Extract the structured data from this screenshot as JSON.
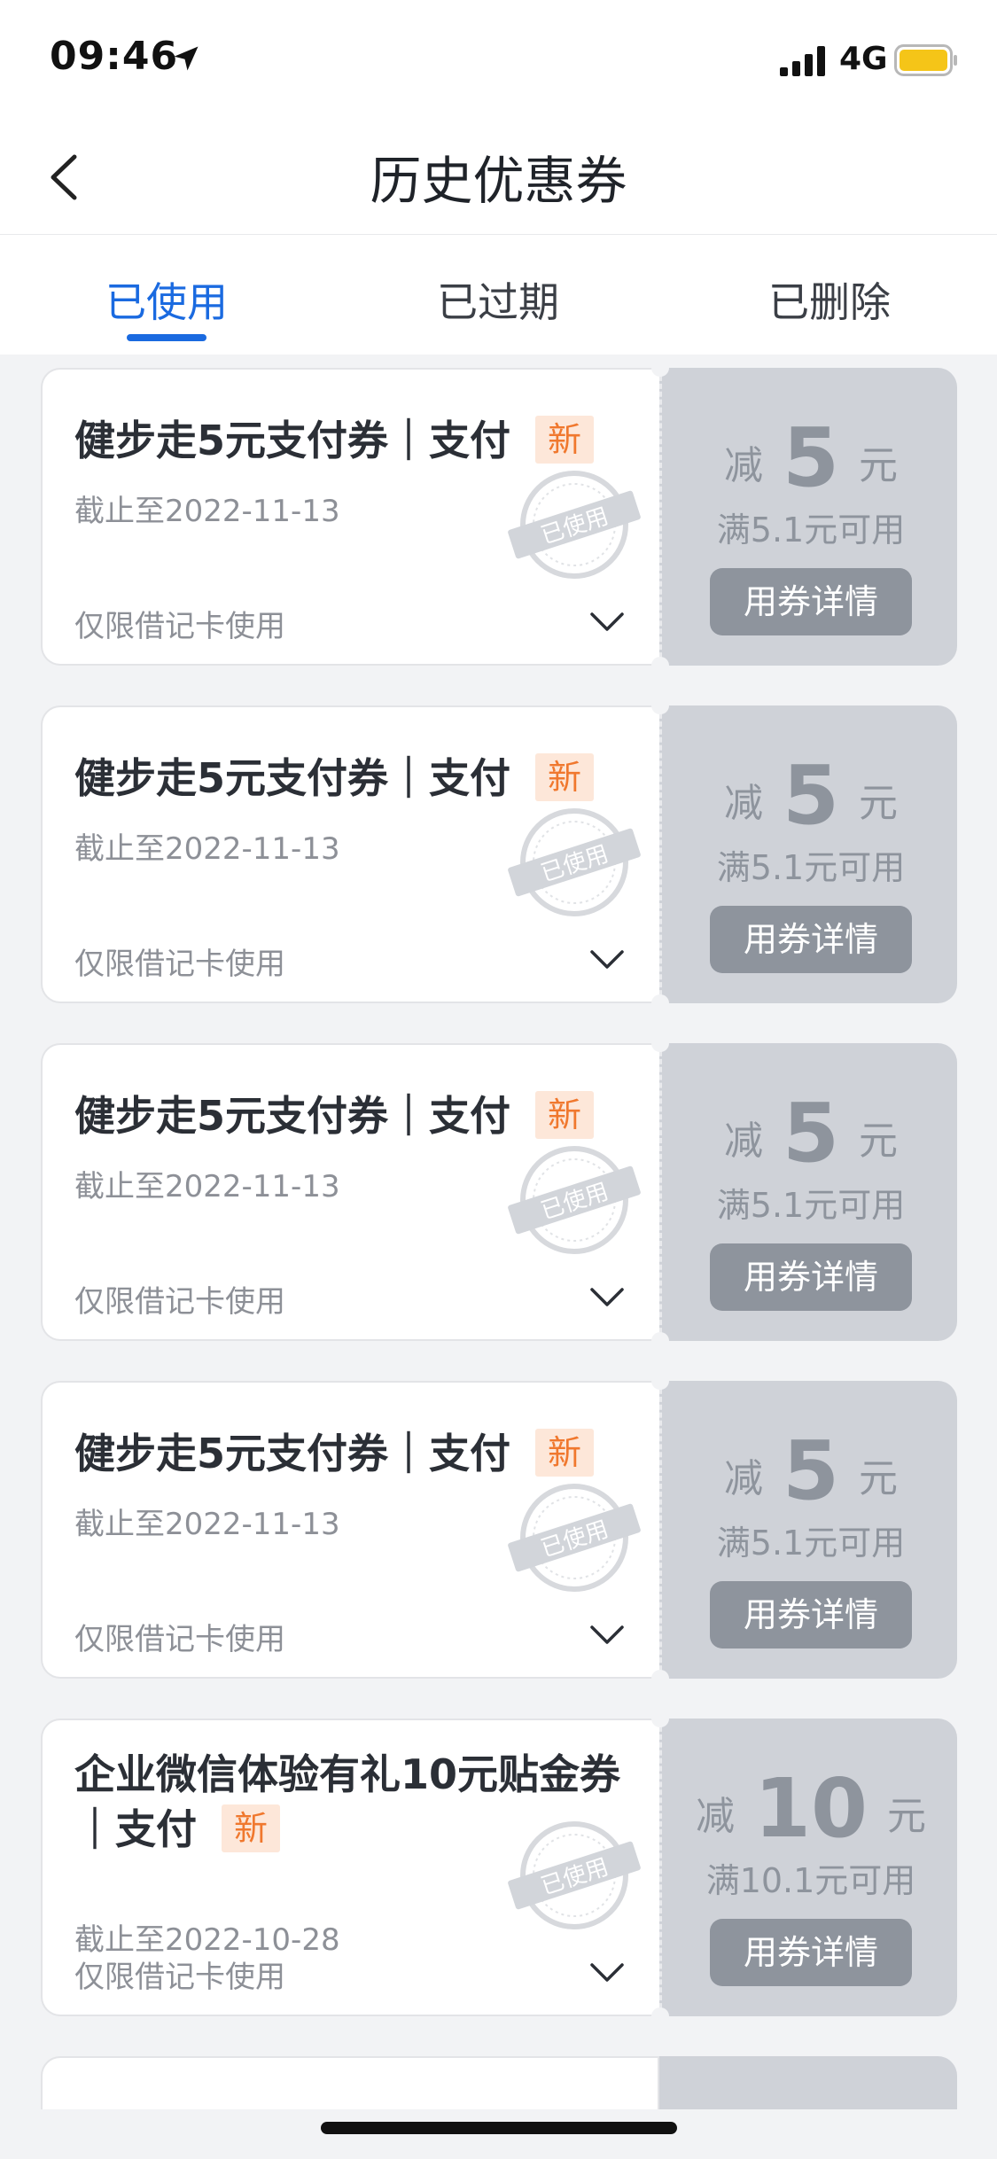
{
  "status_bar": {
    "time": "09:46",
    "network": "4G"
  },
  "nav": {
    "title": "历史优惠券"
  },
  "tabs": [
    {
      "label": "已使用",
      "active": true
    },
    {
      "label": "已过期",
      "active": false
    },
    {
      "label": "已删除",
      "active": false
    }
  ],
  "coupons": [
    {
      "title_main": "健步走5元支付券｜支付",
      "badge": "新",
      "expiry": "截止至2022-11-13",
      "limit": "仅限借记卡使用",
      "prefix": "减",
      "amount": "5",
      "unit": "元",
      "condition": "满5.1元可用",
      "button": "用券详情"
    },
    {
      "title_main": "健步走5元支付券｜支付",
      "badge": "新",
      "expiry": "截止至2022-11-13",
      "limit": "仅限借记卡使用",
      "prefix": "减",
      "amount": "5",
      "unit": "元",
      "condition": "满5.1元可用",
      "button": "用券详情"
    },
    {
      "title_main": "健步走5元支付券｜支付",
      "badge": "新",
      "expiry": "截止至2022-11-13",
      "limit": "仅限借记卡使用",
      "prefix": "减",
      "amount": "5",
      "unit": "元",
      "condition": "满5.1元可用",
      "button": "用券详情"
    },
    {
      "title_main": "健步走5元支付券｜支付",
      "badge": "新",
      "expiry": "截止至2022-11-13",
      "limit": "仅限借记卡使用",
      "prefix": "减",
      "amount": "5",
      "unit": "元",
      "condition": "满5.1元可用",
      "button": "用券详情"
    },
    {
      "title_main": "企业微信体验有礼10元贴金券｜支付",
      "badge": "新",
      "expiry": "截止至2022-10-28",
      "limit": "仅限借记卡使用",
      "prefix": "减",
      "amount": "10",
      "unit": "元",
      "condition": "满10.1元可用",
      "button": "用券详情"
    }
  ],
  "stamp_text": "已使用",
  "colors": {
    "accent": "#1a6ae0",
    "badge_text": "#f0782e",
    "badge_bg": "#fde7d9",
    "coupon_used": "#cfd2d8"
  },
  "icons": [
    "location-arrow-icon",
    "signal-icon",
    "battery-icon",
    "back-chevron-icon",
    "chevron-down-icon",
    "used-stamp-icon"
  ]
}
